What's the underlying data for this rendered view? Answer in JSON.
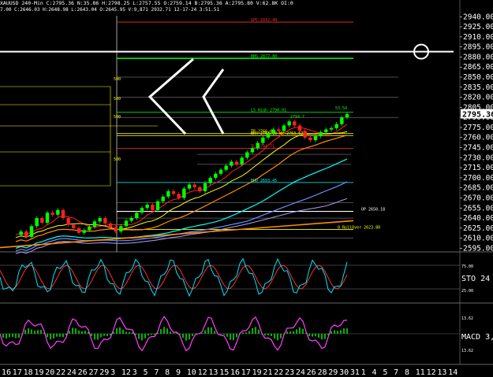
{
  "header": {
    "symbol_line": "XAUUSD  240-Min  C:2795.36  N:35.86  H:2798.25  L:2757.55  O:2759.14  B:2795.36  A:2795.80  V:62.8K  OI:0",
    "ohlc_line": "7.00  C:2646.03  H:2648.98  L:2643.04  O:2645.95  V:9,871  2932.71  12-17-24  3:51.51"
  },
  "colors": {
    "background": "#000000",
    "price": "#ffffff",
    "bull": "#00ff00",
    "bear": "#ff2020",
    "ma_yellow": "#ffff00",
    "ma_orange": "#ff8c00",
    "ma_cyan": "#00ffff",
    "ma_blue": "#6f8fff",
    "ma_purple": "#b0a0ff",
    "sto_fast": "#00e5ff",
    "sto_slow": "#ff3030",
    "macd_line": "#ff40ff",
    "macd_hist": "#00ff00"
  },
  "chart_data": {
    "type": "candlestick",
    "y_range": [
      2592,
      2945
    ],
    "price_axis_ticks": [
      2940,
      2925,
      2910,
      2895,
      2880,
      2865,
      2850,
      2835,
      2820,
      2805,
      2790,
      2775,
      2760,
      2745,
      2730,
      2715,
      2700,
      2685,
      2670,
      2655,
      2640,
      2625,
      2610,
      2595
    ],
    "current_price_label": "2795.36",
    "x_tick_labels": [
      "16",
      "17",
      "18",
      "19",
      "20",
      "22",
      "24",
      "26",
      "27",
      "29",
      "3",
      "12",
      "3",
      "5",
      "7",
      "8",
      "9",
      "10",
      "12",
      "13",
      "15",
      "16",
      "17",
      "19",
      "21",
      "22",
      "23",
      "24",
      "26",
      "28",
      "29",
      "30",
      "31",
      "1",
      "4",
      "5",
      "7",
      "8",
      "11",
      "12",
      "13",
      "14"
    ],
    "close_series": [
      2615,
      2620,
      2612,
      2628,
      2640,
      2633,
      2648,
      2645,
      2652,
      2640,
      2630,
      2625,
      2618,
      2622,
      2627,
      2635,
      2640,
      2632,
      2626,
      2620,
      2628,
      2636,
      2640,
      2648,
      2655,
      2660,
      2652,
      2665,
      2672,
      2680,
      2676,
      2670,
      2684,
      2690,
      2686,
      2680,
      2692,
      2700,
      2706,
      2712,
      2718,
      2724,
      2720,
      2730,
      2738,
      2744,
      2752,
      2760,
      2766,
      2772,
      2770,
      2778,
      2784,
      2778,
      2770,
      2760,
      2756,
      2762,
      2768,
      2772,
      2774,
      2780,
      2790,
      2795
    ],
    "horizontal_levels": [
      {
        "price": 2932,
        "label": "SPC 2932.49",
        "color": "#ff3030"
      },
      {
        "price": 2888,
        "label": "",
        "color": "#ffffff"
      },
      {
        "price": 2878,
        "label": "BHS 2877.80",
        "color": "#00ff00"
      },
      {
        "price": 2798,
        "label": "LS High 2798.01",
        "color": "#00ff00"
      },
      {
        "price": 2766,
        "label": "TR 2766.82",
        "color": "#ffff00"
      },
      {
        "price": 2763,
        "label": "BH4 2763.10 WH 2763.67",
        "color": "#ffff00"
      },
      {
        "price": 2744,
        "label": "TL 2744.71",
        "color": "#ff3030"
      },
      {
        "price": 2693,
        "label": "BHO 2693.45",
        "color": "#00ffff"
      },
      {
        "price": 2650,
        "label": "OP 2650.18",
        "color": "#ffffff"
      },
      {
        "price": 2623,
        "label": "0 RollOver 2623.80",
        "color": "#ffff00"
      }
    ],
    "fib_labels": [
      "500",
      "500",
      "500",
      "500"
    ],
    "sto": {
      "label": "STO 24",
      "levels": [
        "75.00",
        "25.00"
      ]
    },
    "macd": {
      "label": "MACD 3,",
      "levels": [
        "13.62",
        "13.62"
      ]
    },
    "annotation_price": "53.54",
    "annotation_candle": "2794.7"
  }
}
